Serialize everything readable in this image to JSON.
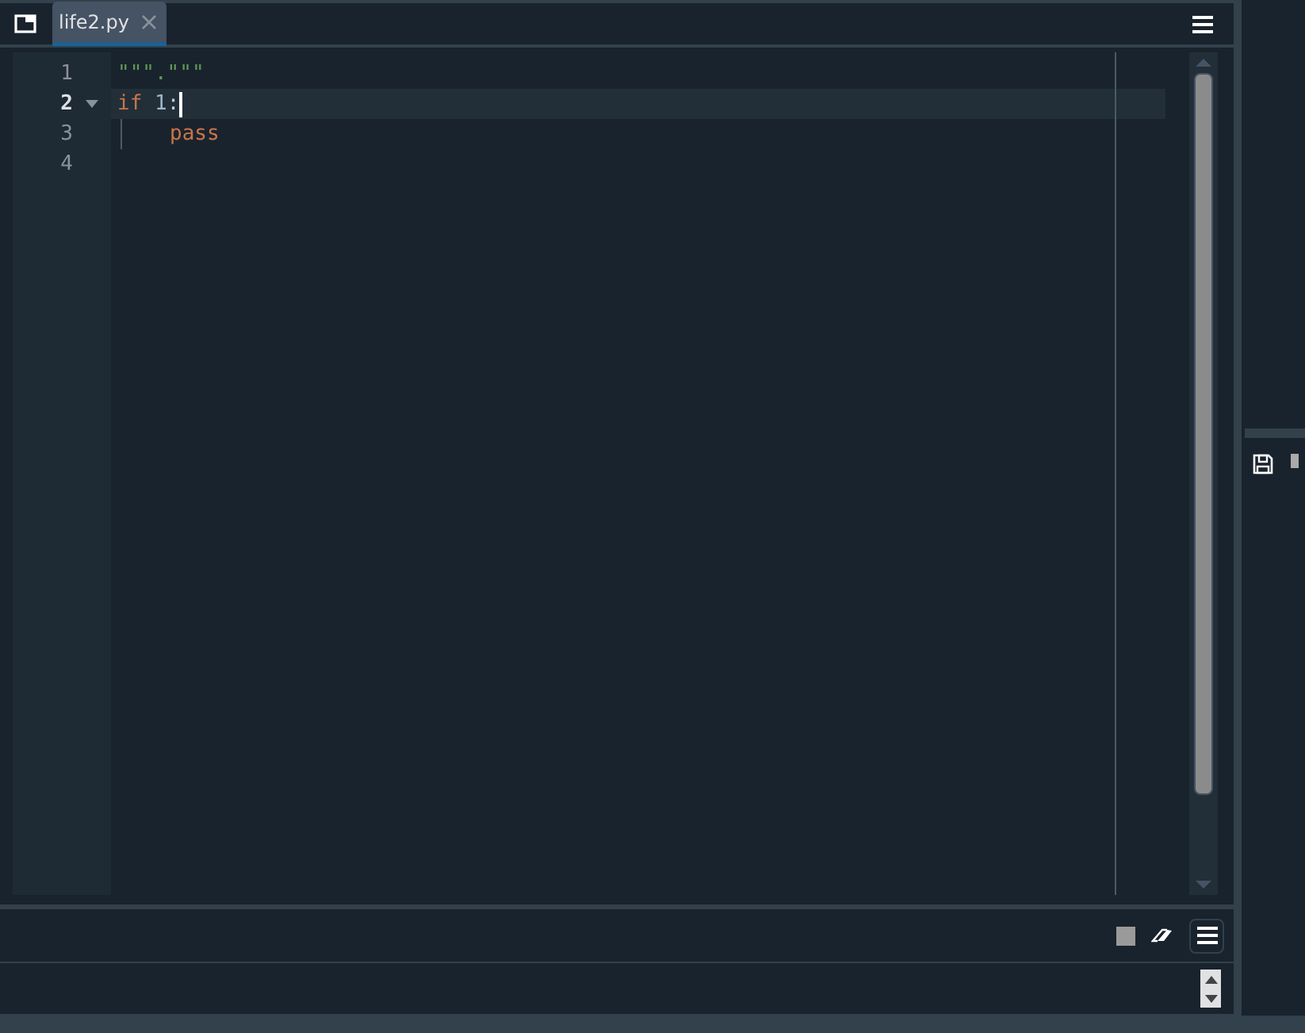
{
  "tab": {
    "title": "life2.py",
    "selected": true
  },
  "lines": [
    {
      "number": "1",
      "current": false,
      "foldable": false,
      "tokens": [
        {
          "kind": "string",
          "text": "\"\"\".\"\"\""
        }
      ]
    },
    {
      "number": "2",
      "current": true,
      "foldable": true,
      "tokens": [
        {
          "kind": "keyword",
          "text": "if"
        },
        {
          "kind": "number",
          "text": " 1"
        },
        {
          "kind": "plain",
          "text": ":"
        }
      ]
    },
    {
      "number": "3",
      "current": false,
      "foldable": false,
      "indented": true,
      "tokens": [
        {
          "kind": "keyword",
          "text": "pass"
        }
      ]
    },
    {
      "number": "4",
      "current": false,
      "foldable": false
    }
  ]
}
